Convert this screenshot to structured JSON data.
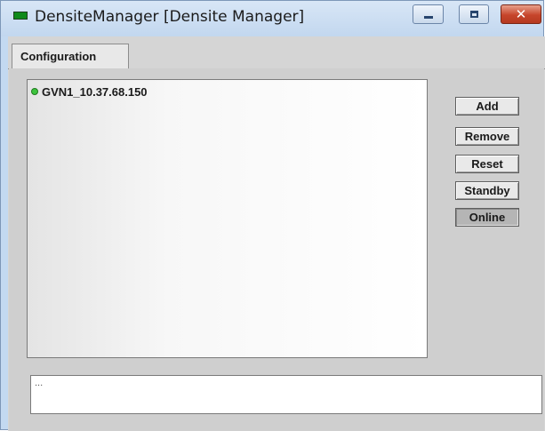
{
  "window": {
    "title": "DensiteManager [Densite Manager]",
    "icon": "app-status-icon",
    "controls": {
      "minimize_icon": "minimize-icon",
      "maximize_icon": "maximize-icon",
      "close_icon": "close-icon",
      "close_glyph": "✕"
    }
  },
  "tabs": [
    {
      "label": "Configuration",
      "active": true
    }
  ],
  "device_list": {
    "items": [
      {
        "name": "GVN1_10.37.68.150",
        "status": "online",
        "status_color": "#3dc43d"
      }
    ]
  },
  "buttons": {
    "add": "Add",
    "remove": "Remove",
    "reset": "Reset",
    "standby": "Standby",
    "online": "Online"
  },
  "message": {
    "text": "..."
  },
  "colors": {
    "accent_close": "#c6452b",
    "status_online": "#3dc43d"
  }
}
